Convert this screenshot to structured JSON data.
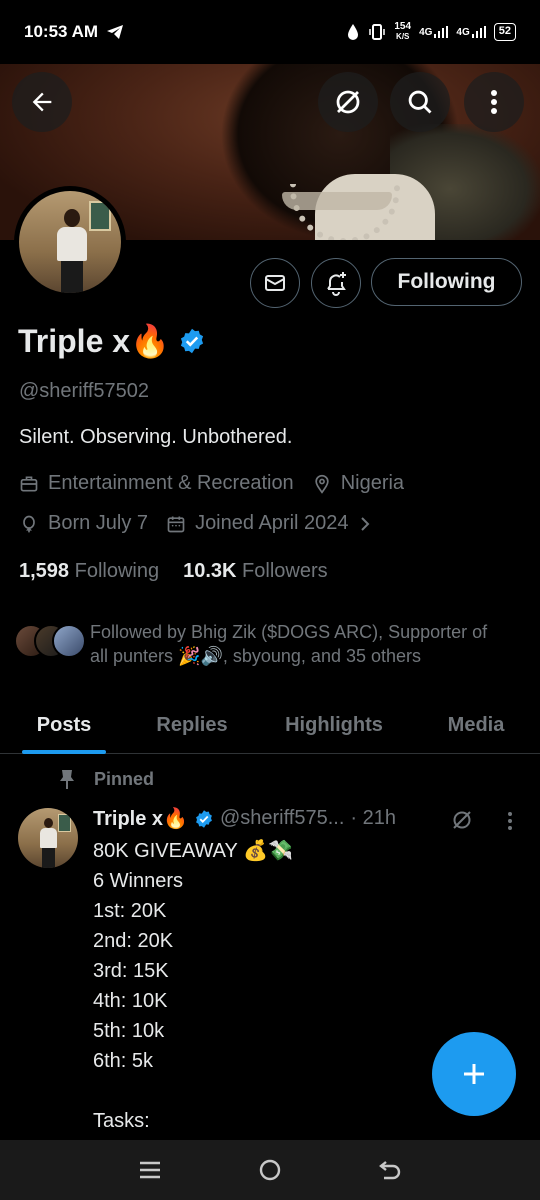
{
  "status_bar": {
    "time": "10:53 AM",
    "speed": "154",
    "speed_unit": "K/S",
    "net1": "4G",
    "net2": "4G",
    "battery": "52"
  },
  "profile": {
    "display_name": "Triple x🔥",
    "handle": "@sheriff57502",
    "bio": "Silent. Observing. Unbothered.",
    "category": "Entertainment & Recreation",
    "location": "Nigeria",
    "born": "Born July 7",
    "joined": "Joined April 2024",
    "following_count": "1,598",
    "following_label": "Following",
    "followers_count": "10.3K",
    "followers_label": "Followers",
    "followed_by": "Followed by Bhig Zik ($DOGS ARC), Supporter of all punters 🎉🔊, sbyoung, and 35 others",
    "follow_button": "Following"
  },
  "tabs": [
    "Posts",
    "Replies",
    "Highlights",
    "Media"
  ],
  "post": {
    "pinned_label": "Pinned",
    "name": "Triple x🔥",
    "handle": "@sheriff575...",
    "time": "· 21h",
    "lines": [
      "80K GIVEAWAY 💰💸",
      "6 Winners",
      "1st: 20K",
      "2nd: 20K",
      "3rd: 15K",
      "4th: 10K",
      "5th: 10k",
      "6th: 5k",
      "",
      "Tasks:"
    ]
  },
  "colors": {
    "accent": "#1d9bf0",
    "muted": "#71767b",
    "text": "#e7e9ea"
  }
}
